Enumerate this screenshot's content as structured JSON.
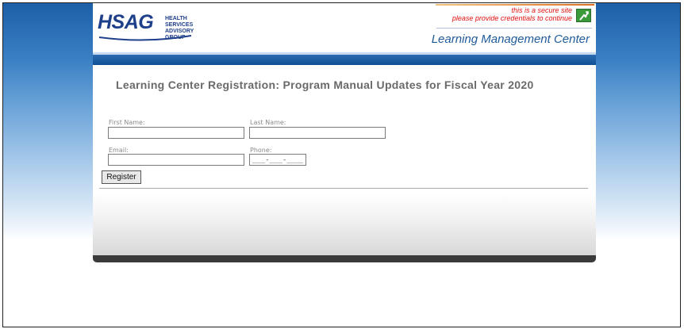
{
  "header": {
    "logo_text": "HSAG",
    "logo_subtitle": "HEALTH SERVICES ADVISORY GROUP",
    "secure_line1": "this is a secure site",
    "secure_line2": "please provide credentials to continue",
    "app_title": "Learning Management Center"
  },
  "form": {
    "title": "Learning Center Registration: Program Manual Updates for Fiscal Year 2020",
    "first_name_label": "First Name:",
    "first_name_value": "",
    "last_name_label": "Last Name:",
    "last_name_value": "",
    "email_label": "Email:",
    "email_value": "",
    "phone_label": "Phone:",
    "phone_value": "___-___-____",
    "register_label": "Register"
  },
  "colors": {
    "brand_blue": "#1e3f8a",
    "secure_red": "#e01010",
    "lock_green": "#3a9a3a"
  },
  "icons": {
    "lock": "lock-icon"
  }
}
